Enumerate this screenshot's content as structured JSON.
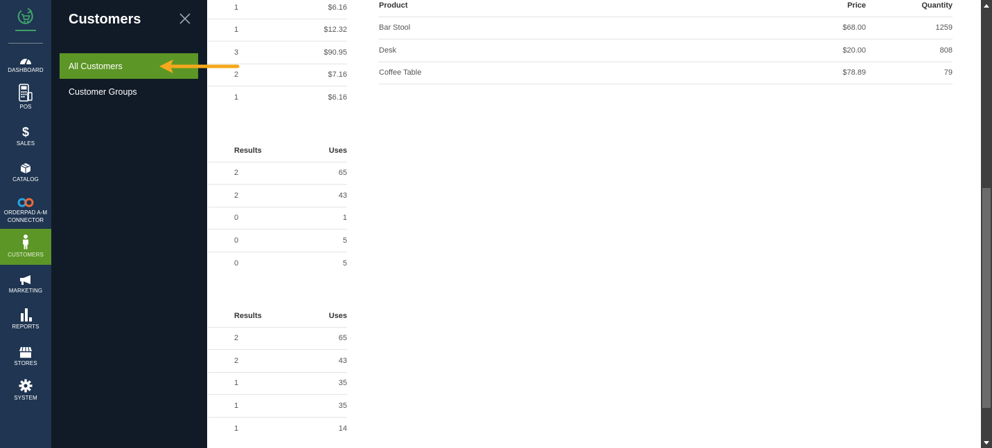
{
  "sidebar": {
    "logo": "orderpad-logo",
    "items": [
      {
        "label": "DASHBOARD",
        "icon": "dashboard-gauge-icon"
      },
      {
        "label": "POS",
        "icon": "pos-terminal-icon"
      },
      {
        "label": "SALES",
        "icon": "dollar-icon"
      },
      {
        "label": "CATALOG",
        "icon": "box-icon"
      },
      {
        "label": "ORDERPAD A-M CONNECTOR",
        "label_line1": "ORDERPAD A-M",
        "label_line2": "CONNECTOR",
        "icon": "connector-link-icon"
      },
      {
        "label": "CUSTOMERS",
        "icon": "person-icon",
        "active": true
      },
      {
        "label": "MARKETING",
        "icon": "megaphone-icon"
      },
      {
        "label": "REPORTS",
        "icon": "bar-chart-icon"
      },
      {
        "label": "STORES",
        "icon": "storefront-icon"
      },
      {
        "label": "SYSTEM",
        "icon": "gear-icon"
      }
    ]
  },
  "flyout": {
    "title": "Customers",
    "close_icon": "close-icon",
    "items": [
      {
        "label": "All Customers",
        "active": true
      },
      {
        "label": "Customer Groups"
      }
    ]
  },
  "annotation": {
    "type": "arrow",
    "color": "#f4a81c",
    "points_to": "All Customers"
  },
  "tables": {
    "orders_partial": {
      "rows": [
        {
          "col1": "1",
          "col2": "$6.16"
        },
        {
          "col1": "1",
          "col2": "$12.32"
        },
        {
          "col1": "3",
          "col2": "$90.95"
        },
        {
          "col1": "2",
          "col2": "$7.16"
        },
        {
          "col1": "1",
          "col2": "$6.16"
        }
      ]
    },
    "search_terms_1": {
      "headers": [
        "Results",
        "Uses"
      ],
      "rows": [
        {
          "results": "2",
          "uses": "65"
        },
        {
          "results": "2",
          "uses": "43"
        },
        {
          "results": "0",
          "uses": "1"
        },
        {
          "results": "0",
          "uses": "5"
        },
        {
          "results": "0",
          "uses": "5"
        }
      ]
    },
    "search_terms_2": {
      "headers": [
        "Results",
        "Uses"
      ],
      "rows": [
        {
          "results": "2",
          "uses": "65"
        },
        {
          "results": "2",
          "uses": "43"
        },
        {
          "results": "1",
          "uses": "35"
        },
        {
          "results": "1",
          "uses": "35"
        },
        {
          "results": "1",
          "uses": "14"
        }
      ]
    },
    "products": {
      "headers": [
        "Product",
        "Price",
        "Quantity"
      ],
      "rows": [
        {
          "product": "Bar Stool",
          "price": "$68.00",
          "quantity": "1259"
        },
        {
          "product": "Desk",
          "price": "$20.00",
          "quantity": "808"
        },
        {
          "product": "Coffee Table",
          "price": "$78.89",
          "quantity": "79"
        }
      ]
    }
  },
  "colors": {
    "sidebar_bg": "#1f3551",
    "flyout_bg": "#111b27",
    "active_green": "#5c9626",
    "logo_green": "#3fa06a",
    "arrow_orange": "#f4a81c"
  }
}
